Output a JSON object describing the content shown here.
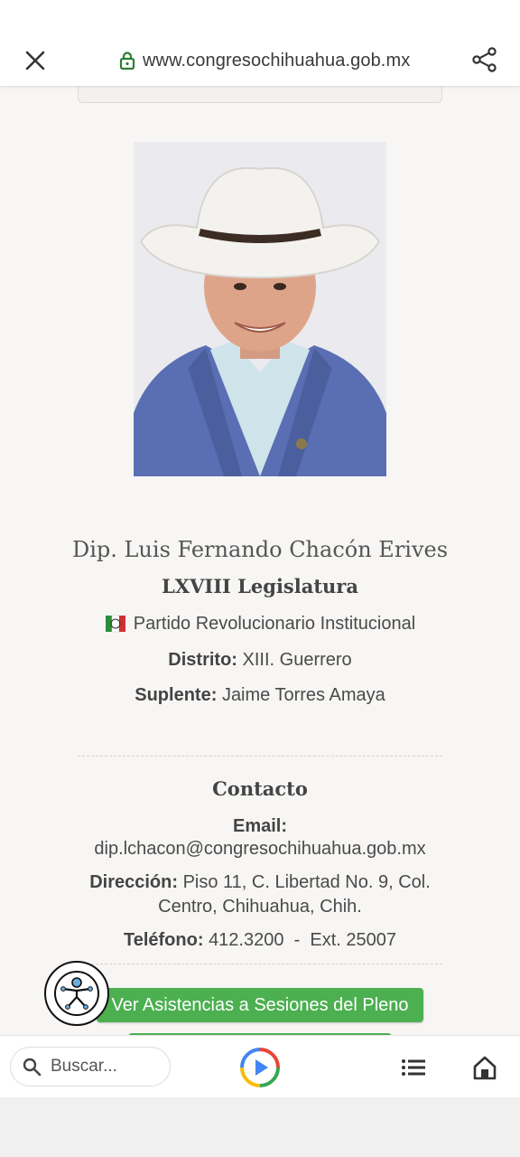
{
  "browser": {
    "url": "www.congresochihuahua.gob.mx"
  },
  "profile": {
    "name": "Dip. Luis Fernando Chacón Erives",
    "legislatura": "LXVIII Legislatura",
    "party": "Partido Revolucionario Institucional",
    "distrito_label": "Distrito:",
    "distrito_value": "XIII. Guerrero",
    "suplente_label": "Suplente:",
    "suplente_value": "Jaime Torres Amaya"
  },
  "contact": {
    "title": "Contacto",
    "email_label": "Email:",
    "email_value": "dip.lchacon@congresochihuahua.gob.mx",
    "direccion_label": "Dirección:",
    "direccion_line1": "Piso 11, C. Libertad No. 9, Col.",
    "direccion_line2": "Centro, Chihuahua, Chih.",
    "telefono_label": "Teléfono:",
    "telefono_value": "412.3200  -  Ext. 25007"
  },
  "actions": {
    "asistencias_label": "Ver Asistencias a Sesiones del Pleno"
  },
  "bottombar": {
    "search_placeholder": "Buscar..."
  },
  "colors": {
    "accent_green": "#4caf50",
    "lock_green": "#2e7d32"
  }
}
